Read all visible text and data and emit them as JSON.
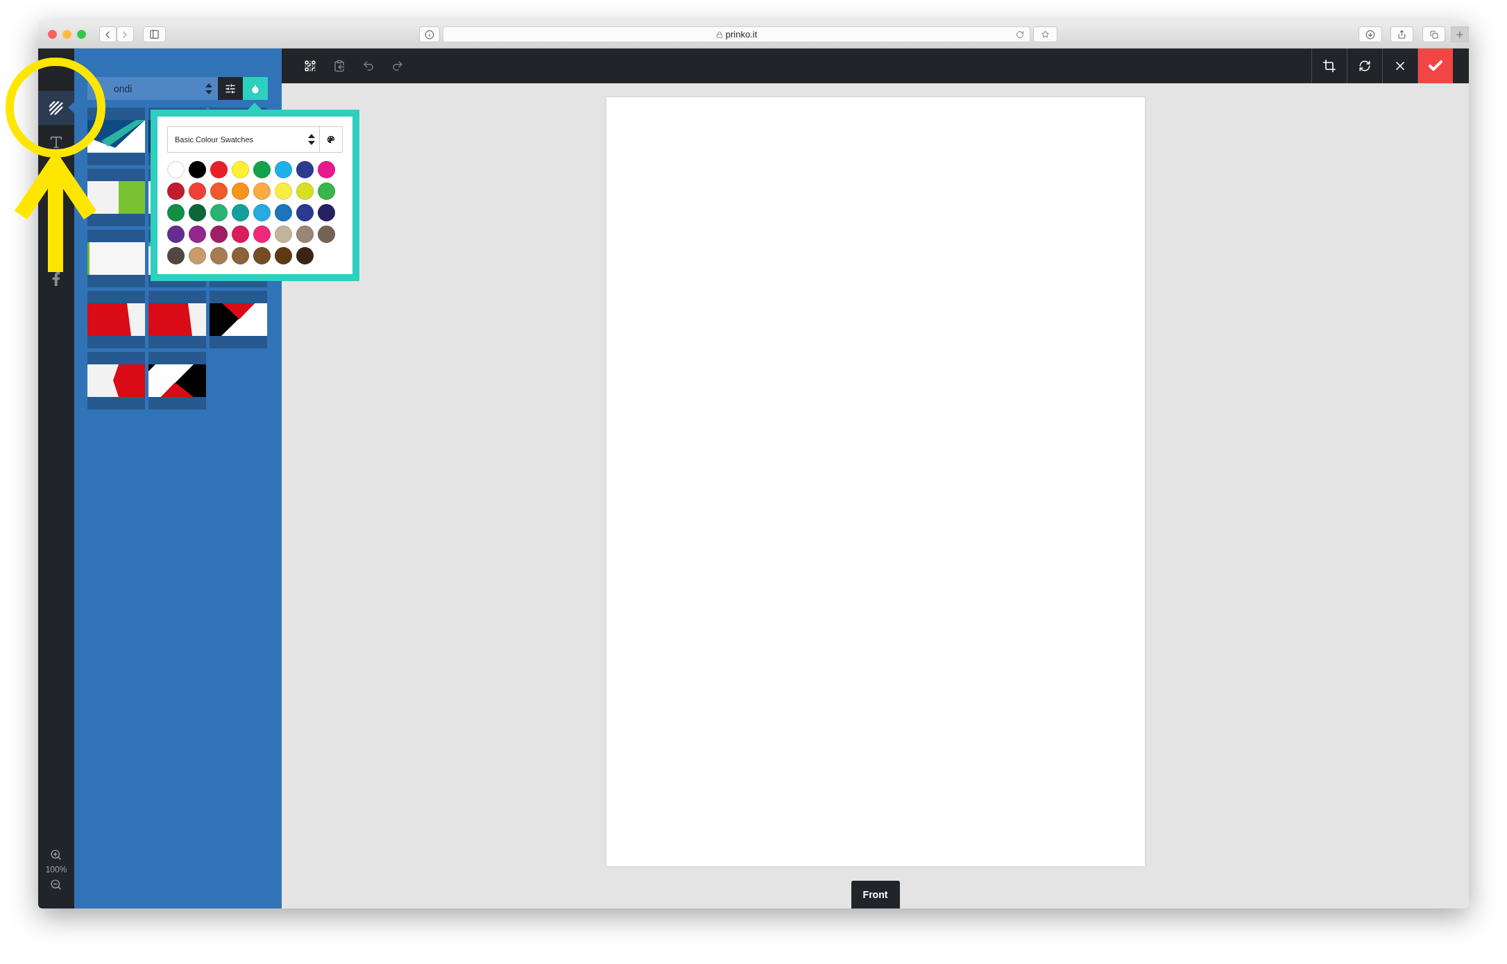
{
  "browser": {
    "url": "prinko.it"
  },
  "sidebar": {
    "tools": [
      {
        "selected": true
      },
      {
        "selected": false
      },
      {
        "selected": false
      }
    ],
    "zoom": "100%"
  },
  "panel": {
    "category": "ondi",
    "buttons": [
      {
        "selected": false
      },
      {
        "selected": true
      }
    ]
  },
  "swatch_popup": {
    "palette": "Basic Colour Swatches",
    "swatches": [
      {
        "color": "#ffffff"
      },
      {
        "color": "#000000"
      },
      {
        "color": "#e8202a"
      },
      {
        "color": "#fff033"
      },
      {
        "color": "#14a34a"
      },
      {
        "color": "#1fb0e8"
      },
      {
        "color": "#2c3a90"
      },
      {
        "color": "#e8198c"
      },
      {
        "color": "#be1e2d"
      },
      {
        "color": "#ef4136"
      },
      {
        "color": "#f05a28"
      },
      {
        "color": "#f7941d"
      },
      {
        "color": "#fbaa44"
      },
      {
        "color": "#f9ed44"
      },
      {
        "color": "#d7df23"
      },
      {
        "color": "#39b54a"
      },
      {
        "color": "#138f45"
      },
      {
        "color": "#0d6539"
      },
      {
        "color": "#2ab373"
      },
      {
        "color": "#14a09a"
      },
      {
        "color": "#27aae1"
      },
      {
        "color": "#1c75bc"
      },
      {
        "color": "#2b3990"
      },
      {
        "color": "#262262"
      },
      {
        "color": "#662d91"
      },
      {
        "color": "#92278f"
      },
      {
        "color": "#9e1f63"
      },
      {
        "color": "#da1c5c"
      },
      {
        "color": "#ee2a7b"
      },
      {
        "color": "#c2b59b"
      },
      {
        "color": "#998675"
      },
      {
        "color": "#736357"
      },
      {
        "color": "#534741"
      },
      {
        "color": "#c69c6d"
      },
      {
        "color": "#a67c52"
      },
      {
        "color": "#8c6239"
      },
      {
        "color": "#754c24"
      },
      {
        "color": "#603913"
      },
      {
        "color": "#3c2415"
      }
    ]
  },
  "page_tab": "Front"
}
